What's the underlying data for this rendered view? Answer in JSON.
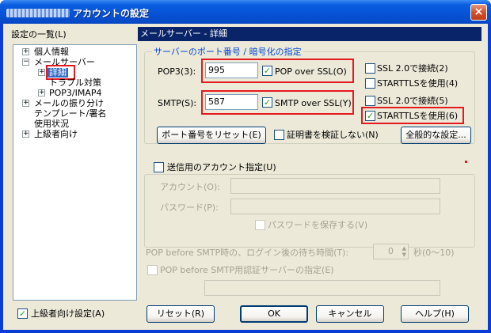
{
  "window": {
    "title": "アカウントの設定",
    "close_symbol": "×"
  },
  "tree": {
    "label": "設定の一覧(L)",
    "items": [
      {
        "label": "個人情報",
        "expander": "+"
      },
      {
        "label": "メールサーバー",
        "expander": "−"
      },
      {
        "label": "詳細",
        "expander": "+"
      },
      {
        "label": "トラブル対策",
        "expander": ""
      },
      {
        "label": "POP3/IMAP4",
        "expander": "+"
      },
      {
        "label": "メールの振り分け",
        "expander": "+"
      },
      {
        "label": "テンプレート/署名",
        "expander": ""
      },
      {
        "label": "使用状況",
        "expander": ""
      },
      {
        "label": "上級者向け",
        "expander": "+"
      }
    ]
  },
  "advanced_checkbox": {
    "label": "上級者向け設定(A)",
    "checked": "✓"
  },
  "panel": {
    "header": "メールサーバー - 詳細"
  },
  "port_group": {
    "title": "サーバーのポート番号 / 暗号化の指定",
    "pop3": {
      "label": "POP3(3):",
      "value": "995",
      "ssl_label": "POP over SSL(O)",
      "ssl_checked": "✓"
    },
    "smtp": {
      "label": "SMTP(S):",
      "value": "587",
      "ssl_label": "SMTP over SSL(Y)",
      "ssl_checked": "✓"
    },
    "pop_ssl2_label": "SSL 2.0で接続(2)",
    "pop_starttls_label": "STARTTLSを使用(4)",
    "smtp_ssl2_label": "SSL 2.0で接続(5)",
    "smtp_starttls_label": "STARTTLSを使用(6)",
    "smtp_starttls_checked": "✓",
    "reset_ports_button": "ポート番号をリセット(E)",
    "no_verify_cert_label": "証明書を検証しない(N)",
    "general_settings_button": "全般的な設定..."
  },
  "send_group": {
    "title": "送信用のアカウント指定(U)",
    "account_label": "アカウント(O):",
    "password_label": "パスワード(P):",
    "save_password_label": "パスワードを保存する(V)"
  },
  "pop_before_smtp": {
    "wait_label": "POP before SMTP時の、ログイン後の待ち時間(T):",
    "wait_value": "0",
    "wait_unit": "秒(0〜10)",
    "auth_server_label": "POP before SMTP用認証サーバーの指定(E)"
  },
  "buttons": {
    "reset": "リセット(R)",
    "ok": "OK",
    "cancel": "キャンセル",
    "help": "ヘルプ(H)"
  },
  "colors": {
    "highlight_box": "#e6181f",
    "header_bg": "#0a246a",
    "selected_item": "#316ac5"
  }
}
